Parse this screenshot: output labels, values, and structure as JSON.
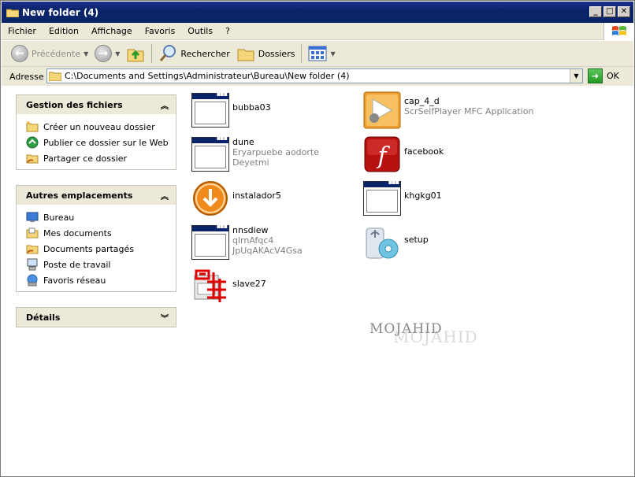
{
  "window": {
    "title": "New folder (4)"
  },
  "menubar": {
    "items": [
      "Fichier",
      "Edition",
      "Affichage",
      "Favoris",
      "Outils",
      "?"
    ]
  },
  "toolbar": {
    "back_label": "Précédente",
    "search_label": "Rechercher",
    "folders_label": "Dossiers"
  },
  "addressbar": {
    "label": "Adresse",
    "path": "C:\\Documents and Settings\\Administrateur\\Bureau\\New folder (4)",
    "go_label": "OK"
  },
  "tasks": {
    "file_tasks": {
      "title": "Gestion des fichiers",
      "items": [
        "Créer un nouveau dossier",
        "Publier ce dossier sur le Web",
        "Partager ce dossier"
      ]
    },
    "other_places": {
      "title": "Autres emplacements",
      "items": [
        "Bureau",
        "Mes documents",
        "Documents partagés",
        "Poste de travail",
        "Favoris réseau"
      ]
    },
    "details": {
      "title": "Détails"
    }
  },
  "files": [
    {
      "name": "bubba03",
      "lines": [],
      "icon": "app-window-icon"
    },
    {
      "name": "cap_4_d",
      "lines": [
        "ScrSelfPlayer MFC Application"
      ],
      "icon": "player-icon"
    },
    {
      "name": "dune",
      "lines": [
        "Eryarpuebe aodorte",
        "Deyetmi"
      ],
      "icon": "app-window-icon"
    },
    {
      "name": "facebook",
      "lines": [],
      "icon": "flash-icon"
    },
    {
      "name": "instalador5",
      "lines": [],
      "icon": "download-icon"
    },
    {
      "name": "khgkg01",
      "lines": [],
      "icon": "app-window-icon"
    },
    {
      "name": "nnsdiew",
      "lines": [
        "qlrnAfqc4",
        "JpUqAKAcV4Gsa"
      ],
      "icon": "app-window-icon"
    },
    {
      "name": "setup",
      "lines": [],
      "icon": "setup-icon"
    },
    {
      "name": "slave27",
      "lines": [],
      "icon": "chinese-char-icon"
    }
  ],
  "watermark": {
    "text": "MOJAHID"
  },
  "colors": {
    "titlebar": "#0a246a",
    "chrome": "#ece9d8"
  }
}
